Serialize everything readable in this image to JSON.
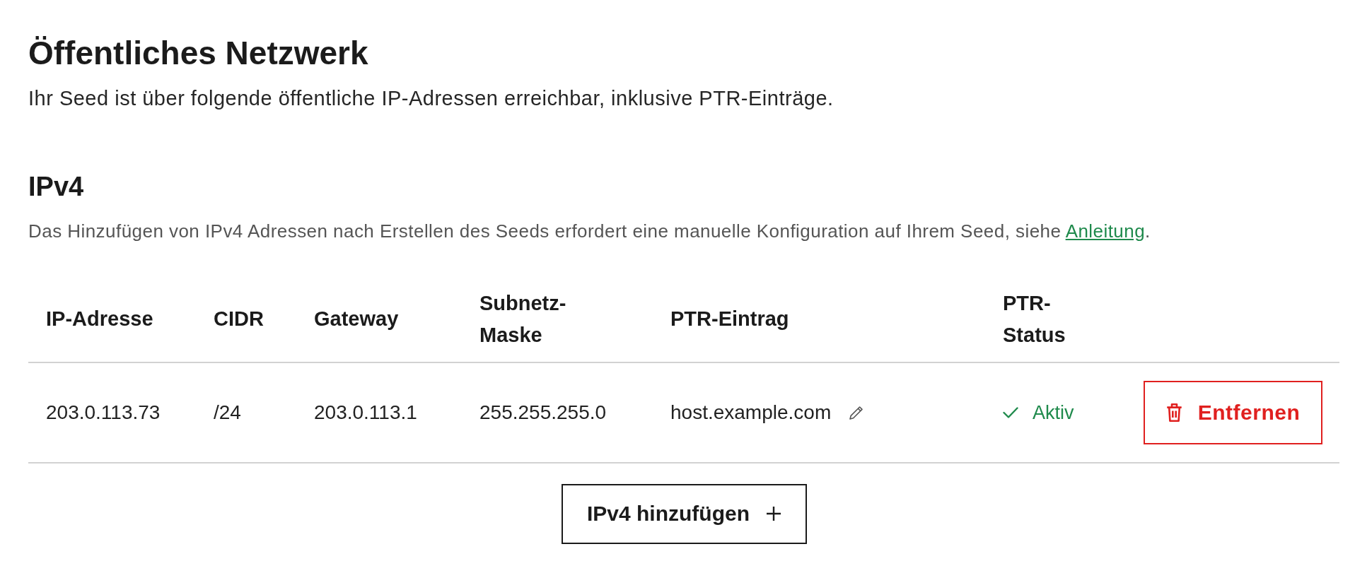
{
  "section": {
    "title": "Öffentliches Netzwerk",
    "description": "Ihr Seed ist über folgende öffentliche IP-Adressen erreichbar, inklusive PTR-Einträge."
  },
  "ipv4": {
    "heading": "IPv4",
    "note": {
      "text": "Das Hinzufügen von IPv4 Adressen nach Erstellen des Seeds erfordert eine manuelle Konfiguration auf Ihrem Seed, siehe",
      "link": "Anleitung",
      "end": "."
    }
  },
  "table": {
    "columns": [
      "IP-Adresse",
      "CIDR",
      "Gateway",
      "Subnetz-Maske",
      "PTR-Eintrag",
      "PTR-Status"
    ],
    "rows": [
      {
        "ip_address": "203.0.113.73",
        "cidr": "/24",
        "gateway": "203.0.113.1",
        "subnet_mask": "255.255.255.0",
        "ptr_record": "host.example.com",
        "ptr_status": {
          "active": true,
          "label": "Aktiv"
        },
        "remove_label": "Entfernen"
      }
    ]
  },
  "add_button": {
    "label": "IPv4 hinzufügen"
  }
}
